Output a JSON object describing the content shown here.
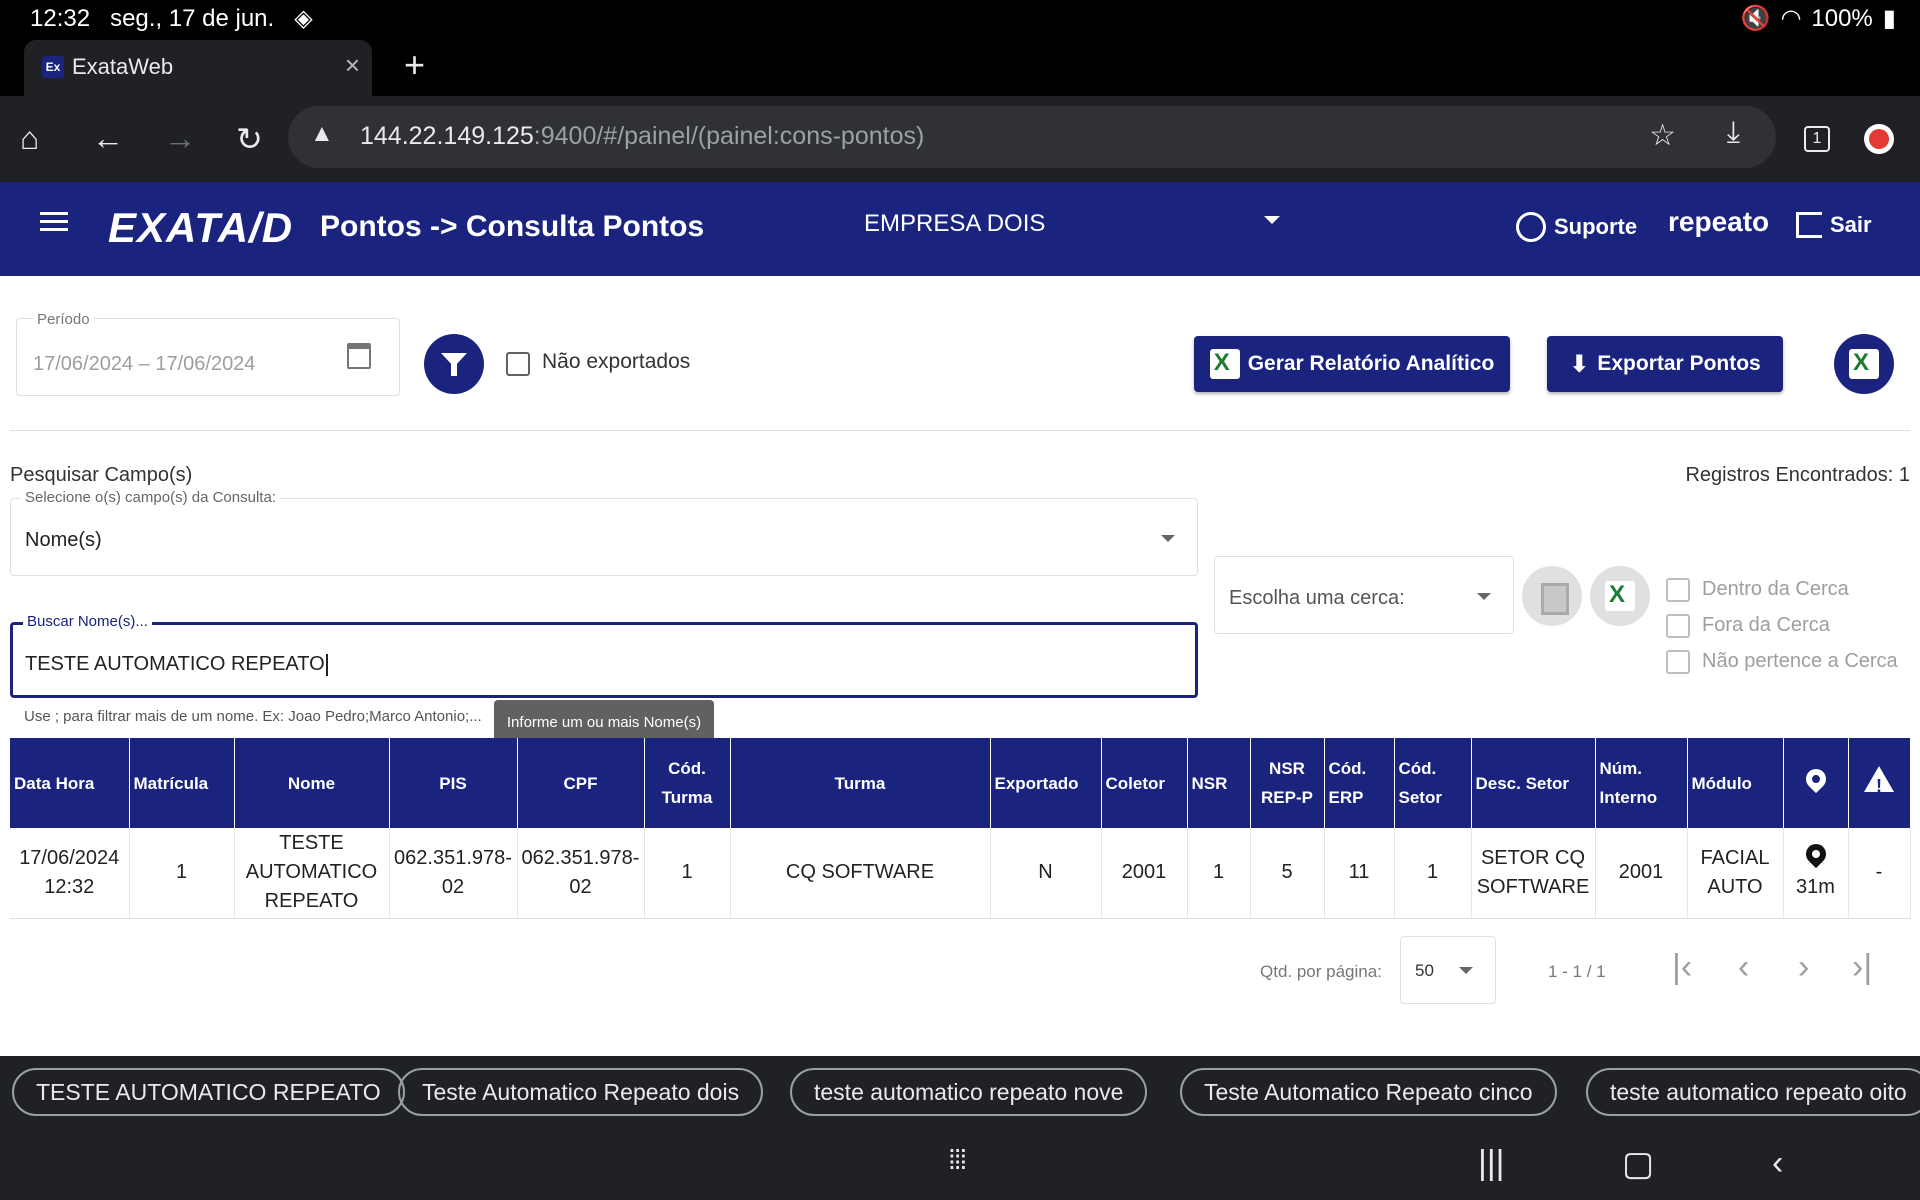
{
  "status": {
    "time": "12:32",
    "date": "seg., 17 de jun.",
    "battery": "100%"
  },
  "browser": {
    "tab_title": "ExataWeb",
    "tab_favicon": "Ex",
    "url_host": "144.22.149.125",
    "url_rest": ":9400/#/painel/(painel:cons-pontos)",
    "tabs_count": "1"
  },
  "appbar": {
    "logo": "EXATA/D",
    "page_title": "Pontos -> Consulta Pontos",
    "company": "EMPRESA DOIS",
    "support": "Suporte",
    "user": "repeato",
    "logout": "Sair"
  },
  "filters": {
    "period_label": "Período",
    "period_value": "17/06/2024 – 17/06/2024",
    "not_exported_label": "Não exportados",
    "report_button": "Gerar Relatório Analítico",
    "export_button": "Exportar Pontos"
  },
  "search": {
    "title": "Pesquisar Campo(s)",
    "records": "Registros Encontrados: 1",
    "fields_label": "Selecione o(s) campo(s) da Consulta:",
    "fields_value": "Nome(s)",
    "names_label": "Buscar Nome(s)...",
    "names_value": "TESTE AUTOMATICO REPEATO",
    "hint": "Use ; para filtrar mais de um nome. Ex: Joao Pedro;Marco Antonio;...",
    "tooltip": "Informe um ou mais Nome(s)",
    "fence_placeholder": "Escolha uma cerca:",
    "fence_options": [
      "Dentro da Cerca",
      "Fora da Cerca",
      "Não pertence a Cerca"
    ]
  },
  "table": {
    "headers": [
      "Data Hora",
      "Matrícula",
      "Nome",
      "PIS",
      "CPF",
      "Cód. Turma",
      "Turma",
      "Exportado",
      "Coletor",
      "NSR",
      "NSR REP-P",
      "Cód. ERP",
      "Cód. Setor",
      "Desc. Setor",
      "Núm. Interno",
      "Módulo"
    ],
    "rows": [
      {
        "data_hora": "17/06/2024 12:32",
        "matricula": "1",
        "nome": "TESTE AUTOMATICO REPEATO",
        "pis": "062.351.978-02",
        "cpf": "062.351.978-02",
        "cod_turma": "1",
        "turma": "CQ SOFTWARE",
        "exportado": "N",
        "coletor": "2001",
        "nsr": "1",
        "nsr_rep_p": "5",
        "cod_erp": "11",
        "cod_setor": "1",
        "desc_setor": "SETOR CQ SOFTWARE",
        "num_interno": "2001",
        "modulo": "FACIAL AUTO",
        "distancia": "31m",
        "alerta": "-"
      }
    ]
  },
  "paginator": {
    "per_page_label": "Qtd. por página:",
    "per_page_value": "50",
    "range": "1 - 1 / 1"
  },
  "suggestions": [
    "TESTE AUTOMATICO REPEATO",
    "Teste Automatico Repeato dois",
    "teste automatico repeato nove",
    "Teste Automatico Repeato cinco",
    "teste automatico repeato oito"
  ],
  "colors": {
    "primary": "#1a237e",
    "browser_bg": "#202124"
  }
}
